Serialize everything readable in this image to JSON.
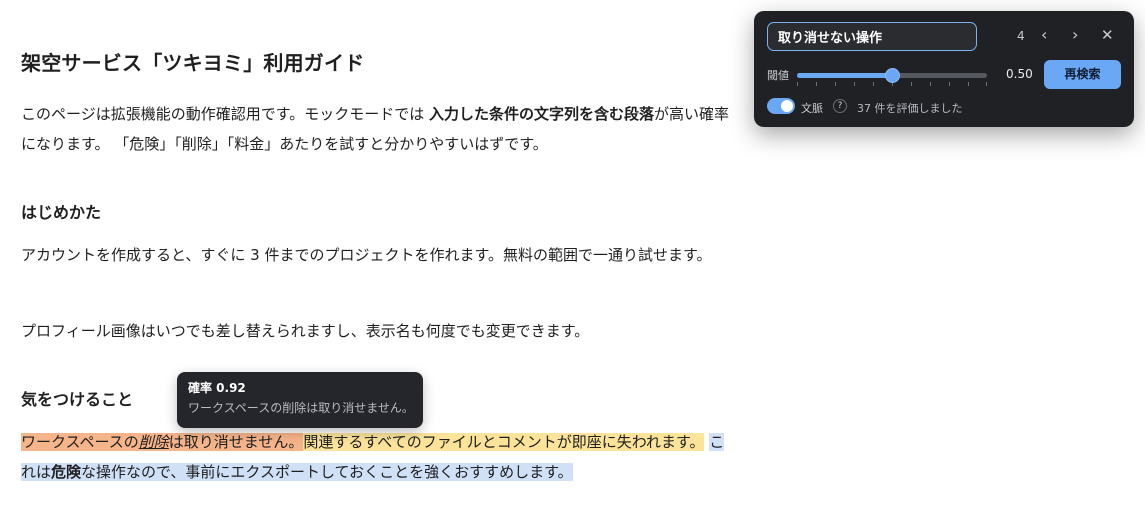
{
  "document": {
    "title": "架空サービス「ツキヨミ」利用ガイド",
    "intro": {
      "part1": "このページは拡張機能の動作確認用です。モックモードでは ",
      "bold": "入力した条件の文字列を含む段落",
      "part2": "が高い確率になります。 「危険」「削除」「料金」あたりを試すと分かりやすいはずです。"
    },
    "section1": {
      "heading": "はじめかた",
      "p1": "アカウントを作成すると、すぐに 3 件までのプロジェクトを作れます。無料の範囲で一通り試せます。",
      "p2": "プロフィール画像はいつでも差し替えられますし、表示名も何度でも変更できます。"
    },
    "section2": {
      "heading": "気をつけること",
      "seg1a": "ワークスペースの",
      "seg1b": "削除",
      "seg1c": "は取り消せません。",
      "seg2": "関連するすべてのファイルとコメントが即座に失われます。",
      "seg3a": "これは",
      "seg3b": "危険",
      "seg3c": "な操作なので、事前にエクスポートしておくことを強くおすすめします。"
    }
  },
  "tooltip": {
    "title": "確率 0.92",
    "text": "ワークスペースの削除は取り消せません。"
  },
  "panel": {
    "query": "取り消せない操作",
    "count": "4",
    "prev": "‹",
    "next": "›",
    "close": "✕",
    "threshold_label": "閾値",
    "threshold": 0.5,
    "threshold_text": "0.50",
    "rescan_label": "再検索",
    "context_label": "文脈",
    "context_on": true,
    "help": "?",
    "evaluated": "37 件を評価しました"
  },
  "colors": {
    "accent": "#6aa7f5",
    "highlight_high": "#f6b48a",
    "highlight_mid": "#fbe39a",
    "highlight_low": "#cfe0f7"
  }
}
